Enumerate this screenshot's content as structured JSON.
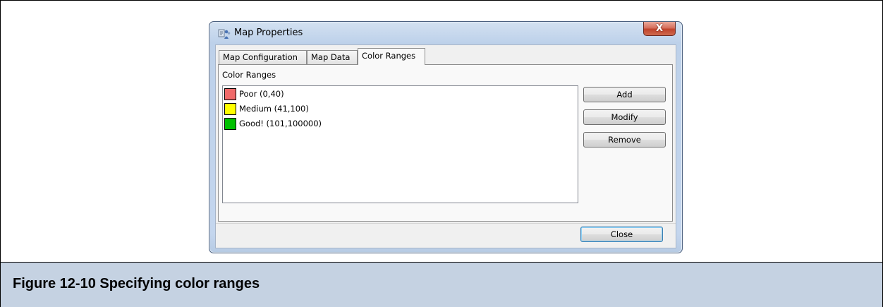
{
  "window": {
    "title": "Map Properties",
    "close_label": "X"
  },
  "tabs": [
    {
      "label": "Map Configuration"
    },
    {
      "label": "Map Data"
    },
    {
      "label": "Color Ranges"
    }
  ],
  "panel": {
    "label": "Color Ranges",
    "items": [
      {
        "label": "Poor (0,40)",
        "color": "#f06a6a"
      },
      {
        "label": "Medium (41,100)",
        "color": "#ffff00"
      },
      {
        "label": "Good! (101,100000)",
        "color": "#00c000"
      }
    ],
    "buttons": {
      "add": "Add",
      "modify": "Modify",
      "remove": "Remove"
    }
  },
  "footer": {
    "close": "Close"
  },
  "caption": "Figure 12-10  Specifying color ranges"
}
